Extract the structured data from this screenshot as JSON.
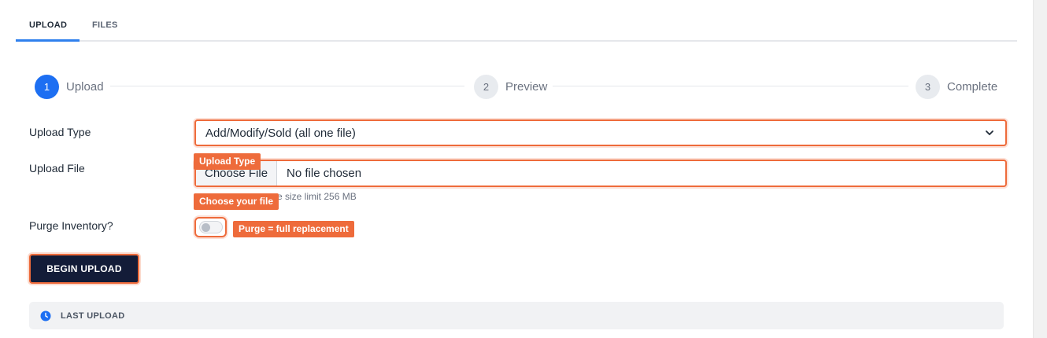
{
  "tabs": [
    {
      "label": "UPLOAD",
      "active": true
    },
    {
      "label": "FILES",
      "active": false
    }
  ],
  "stepper": [
    {
      "number": "1",
      "label": "Upload",
      "active": true
    },
    {
      "number": "2",
      "label": "Preview",
      "active": false
    },
    {
      "number": "3",
      "label": "Complete",
      "active": false
    }
  ],
  "form": {
    "upload_type_label": "Upload Type",
    "upload_type_value": "Add/Modify/Sold (all one file)",
    "upload_file_label": "Upload File",
    "choose_file_label": "Choose File",
    "file_status": "No file chosen",
    "file_hint": "e size limit 256 MB",
    "purge_label": "Purge Inventory?",
    "purge_enabled": false,
    "begin_upload_label": "BEGIN UPLOAD"
  },
  "annotations": {
    "upload_type_tag": "Upload Type",
    "choose_file_tag": "Choose your file",
    "purge_tag": "Purge = full replacement"
  },
  "last_upload": {
    "label": "LAST UPLOAD"
  },
  "colors": {
    "accent": "#1d6ff2",
    "highlight": "#ee6b3b",
    "primary_button": "#131c38"
  },
  "icons": {
    "dropdown": "chevron-down-icon",
    "last_upload": "clock-icon"
  }
}
